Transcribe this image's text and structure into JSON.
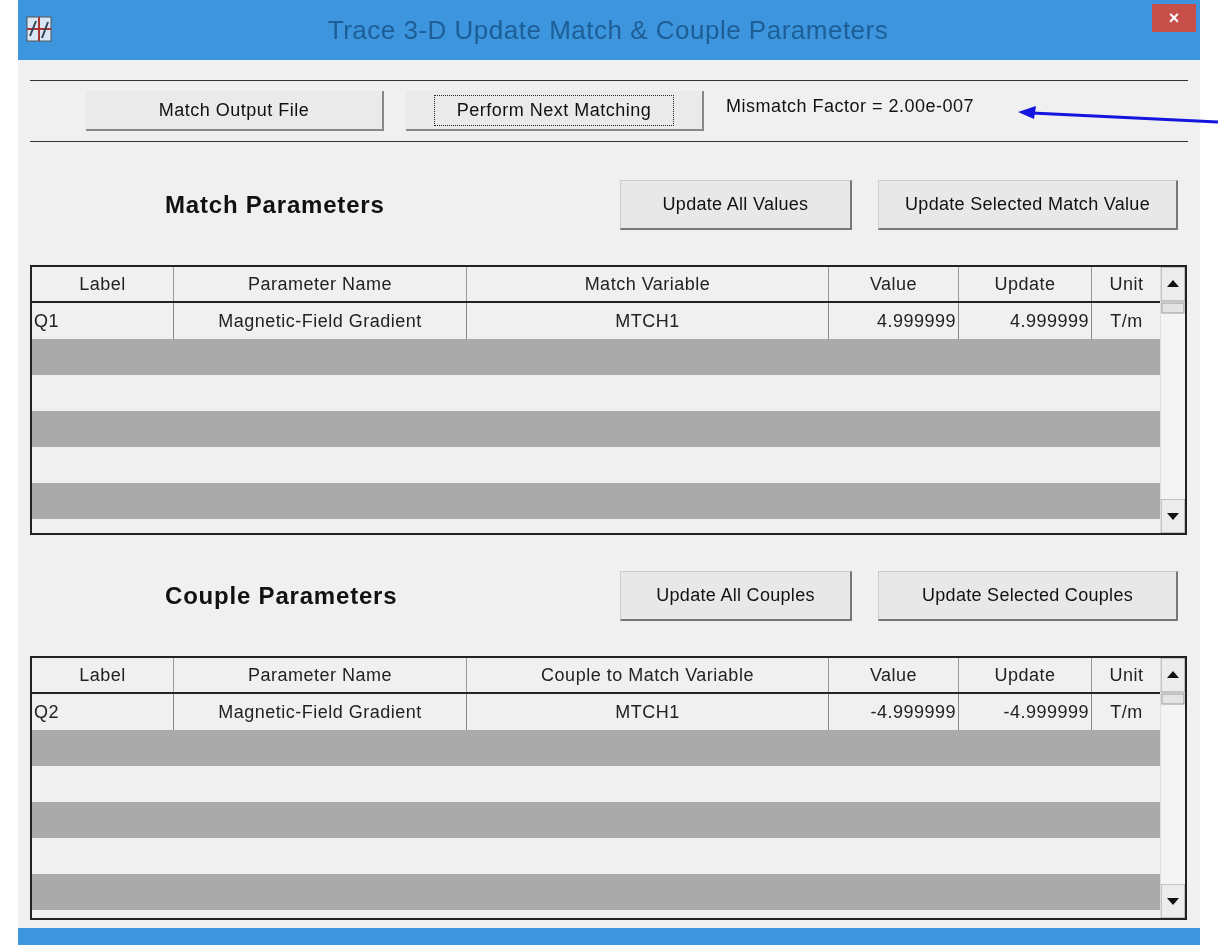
{
  "window": {
    "title": "Trace 3-D Update Match & Couple Parameters",
    "close": "×"
  },
  "toolbar": {
    "buttons": [
      {
        "label": "Match Output File",
        "focused": false
      },
      {
        "label": "Perform Next Matching",
        "focused": true
      }
    ],
    "mismatch": "Mismatch Factor = 2.00e-007"
  },
  "sections": [
    {
      "title": "Match Parameters",
      "buttons": [
        "Update All Values",
        "Update Selected Match Value"
      ],
      "table": {
        "columns": [
          "Label",
          "Parameter Name",
          "Match Variable",
          "Value",
          "Update",
          "Unit"
        ],
        "rows": [
          [
            "Q1",
            "Magnetic-Field Gradient",
            "MTCH1",
            "4.999999",
            "4.999999",
            "T/m"
          ]
        ]
      }
    },
    {
      "title": "Couple Parameters",
      "buttons": [
        "Update All Couples",
        "Update Selected Couples"
      ],
      "table": {
        "columns": [
          "Label",
          "Parameter Name",
          "Couple to Match Variable",
          "Value",
          "Update",
          "Unit"
        ],
        "rows": [
          [
            "Q2",
            "Magnetic-Field Gradient",
            "MTCH1",
            "-4.999999",
            "-4.999999",
            "T/m"
          ]
        ]
      }
    }
  ]
}
